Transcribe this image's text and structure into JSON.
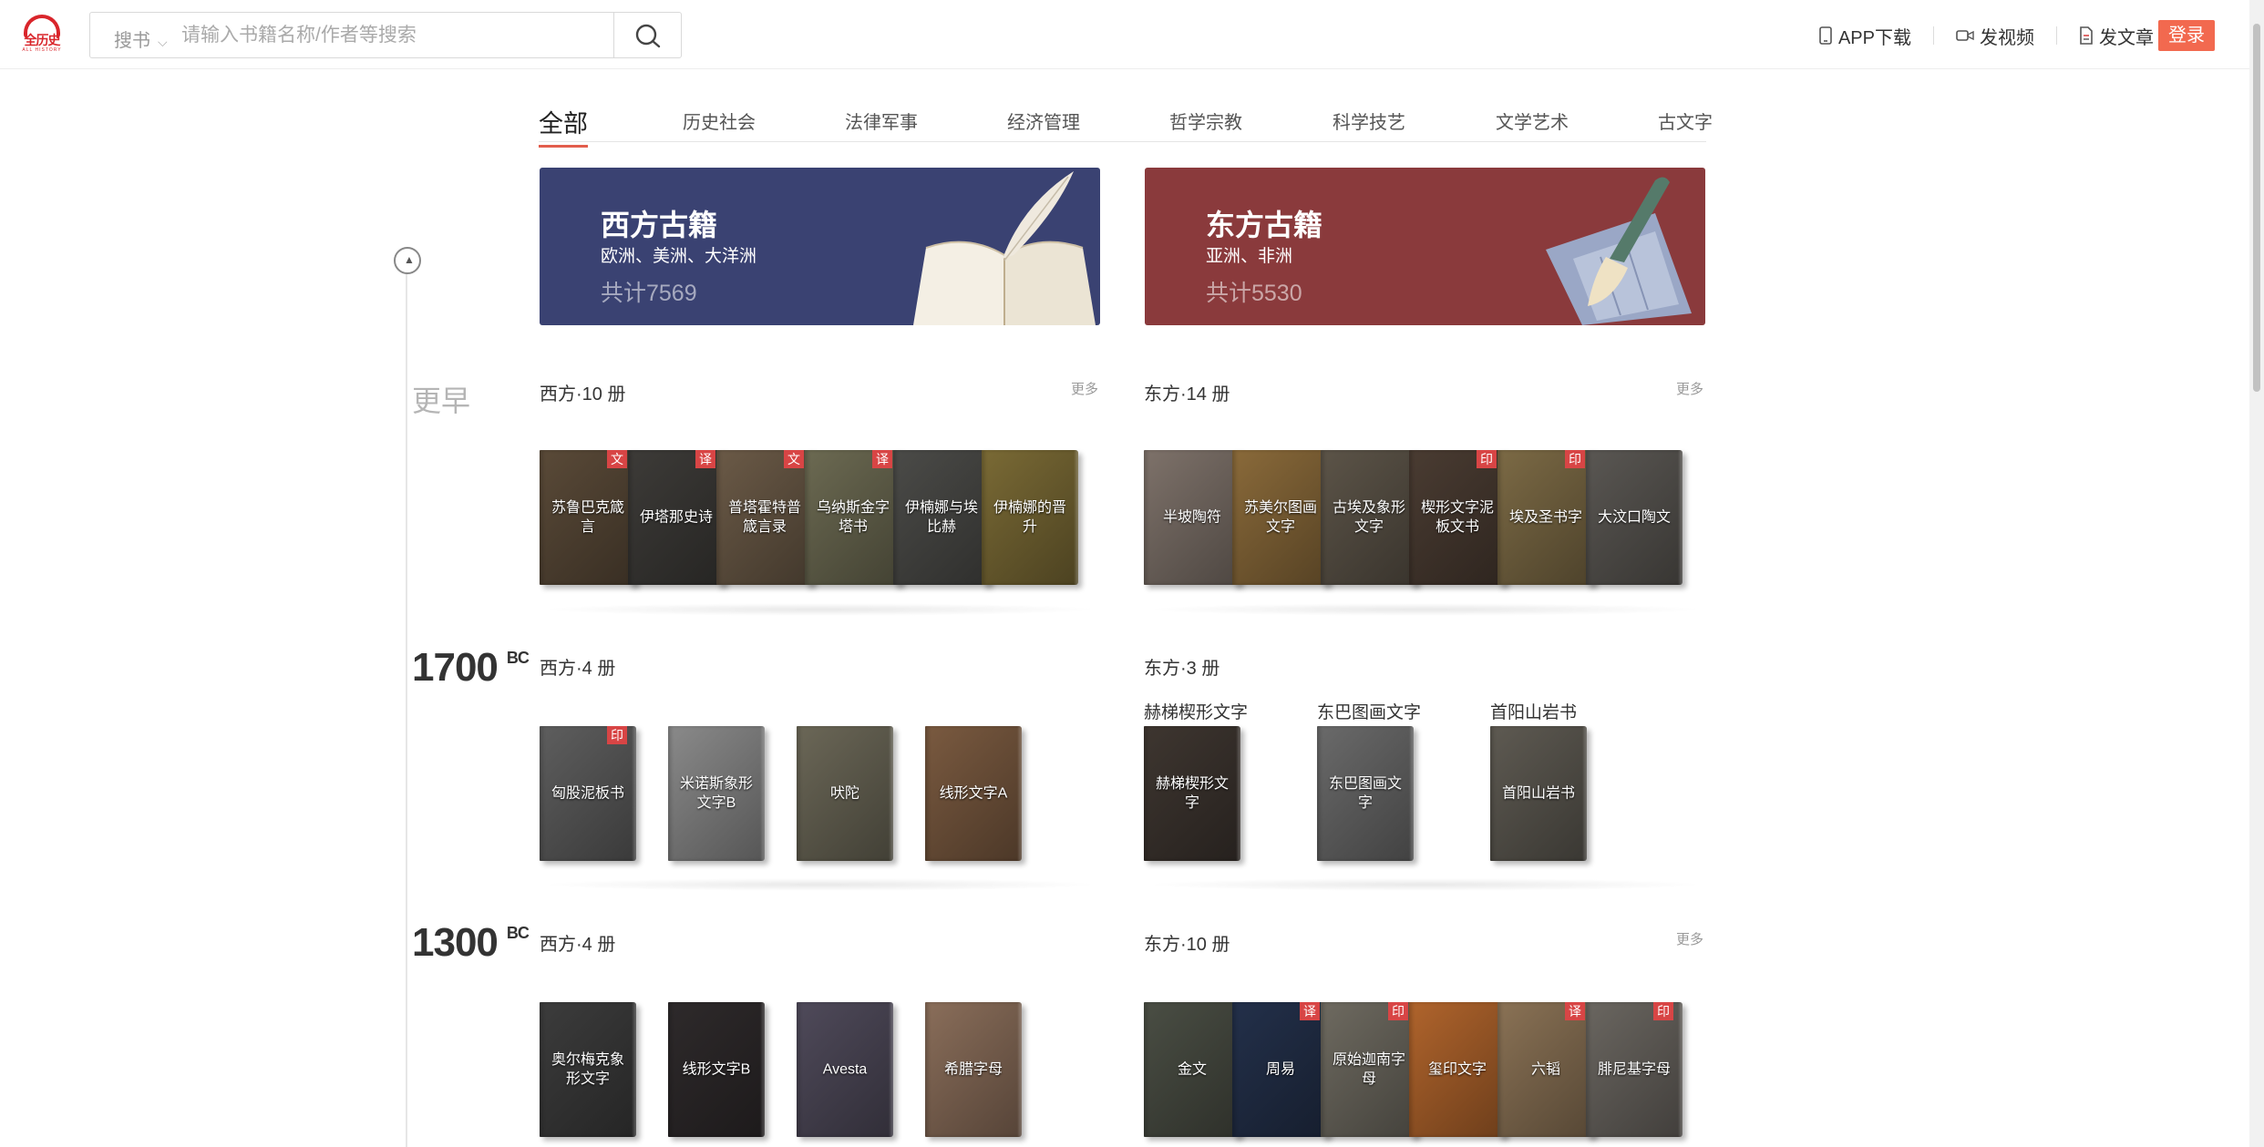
{
  "header": {
    "logo_text": "全历史",
    "logo_sub": "ALL HISTORY",
    "search_category": "搜书",
    "search_placeholder": "请输入书籍名称/作者等搜索",
    "links": [
      "APP下载",
      "发视频",
      "发文章"
    ],
    "login": "登录"
  },
  "tabs": [
    "全部",
    "历史社会",
    "法律军事",
    "经济管理",
    "哲学宗教",
    "科学技艺",
    "文学艺术",
    "古文字"
  ],
  "banners": {
    "west": {
      "title": "西方古籍",
      "subtitle": "欧洲、美洲、大洋洲",
      "count": "共计7569"
    },
    "east": {
      "title": "东方古籍",
      "subtitle": "亚洲、非洲",
      "count": "共计5530"
    }
  },
  "timeline": {
    "earlier": "更早",
    "eras": [
      {
        "year": "1700",
        "suffix": "BC"
      },
      {
        "year": "1300",
        "suffix": "BC"
      }
    ]
  },
  "more_label": "更多",
  "sections": {
    "early_west": {
      "title": "西方·10 册",
      "books": [
        {
          "title": "苏鲁巴克箴言",
          "tag": "文",
          "color": "#5a4a38"
        },
        {
          "title": "伊塔那史诗",
          "tag": "译",
          "color": "#3d3b38"
        },
        {
          "title": "普塔霍特普箴言录",
          "tag": "文",
          "color": "#6b5a47"
        },
        {
          "title": "乌纳斯金字塔书",
          "tag": "译",
          "color": "#6c6a52"
        },
        {
          "title": "伊楠娜与埃比赫",
          "tag": "",
          "color": "#4b4b48"
        },
        {
          "title": "伊楠娜的晋升",
          "tag": "",
          "color": "#7a6a35"
        }
      ]
    },
    "early_east": {
      "title": "东方·14 册",
      "books": [
        {
          "title": "半坡陶符",
          "tag": "",
          "color": "#7e726a"
        },
        {
          "title": "苏美尔图画文字",
          "tag": "",
          "color": "#8a6a3a"
        },
        {
          "title": "古埃及象形文字",
          "tag": "",
          "color": "#5c5448"
        },
        {
          "title": "楔形文字泥板文书",
          "tag": "印",
          "color": "#4a3c32"
        },
        {
          "title": "埃及圣书字",
          "tag": "印",
          "color": "#7c6a45"
        },
        {
          "title": "大汶口陶文",
          "tag": "",
          "color": "#5a5753"
        }
      ]
    },
    "bc1700_west": {
      "title": "西方·4 册",
      "books": [
        {
          "title": "匈股泥板书",
          "tag": "印",
          "color": "#5e5e5e"
        },
        {
          "title": "米诺斯象形文字B",
          "tag": "",
          "color": "#8a8a8a"
        },
        {
          "title": "吠陀",
          "tag": "",
          "color": "#6b6757"
        },
        {
          "title": "线形文字A",
          "tag": "",
          "color": "#7a5a40"
        }
      ]
    },
    "bc1700_east": {
      "title": "东方·3 册",
      "groups": [
        {
          "label": "赫梯楔形文字",
          "book": "赫梯楔形文字",
          "color": "#3e3630"
        },
        {
          "label": "东巴图画文字",
          "book": "东巴图画文字",
          "color": "#6a6a6a"
        },
        {
          "label": "首阳山岩书",
          "book": "首阳山岩书",
          "color": "#5e5a52"
        }
      ]
    },
    "bc1300_west": {
      "title": "西方·4 册",
      "books": [
        {
          "title": "奥尔梅克象形文字",
          "tag": "",
          "color": "#3c3c3c"
        },
        {
          "title": "线形文字B",
          "tag": "",
          "color": "#2e2a2b"
        },
        {
          "title": "Avesta",
          "tag": "",
          "color": "#4f4a5a"
        },
        {
          "title": "希腊字母",
          "tag": "",
          "color": "#8a6e5a"
        }
      ]
    },
    "bc1300_east": {
      "title": "东方·10 册",
      "books": [
        {
          "title": "金文",
          "tag": "",
          "color": "#4a4e44"
        },
        {
          "title": "周易",
          "tag": "译",
          "color": "#23304a"
        },
        {
          "title": "原始迦南字母",
          "tag": "印",
          "color": "#6e6a60"
        },
        {
          "title": "玺印文字",
          "tag": "",
          "color": "#b0642c"
        },
        {
          "title": "六韬",
          "tag": "译",
          "color": "#8a7255"
        },
        {
          "title": "腓尼基字母",
          "tag": "印",
          "color": "#6a6660"
        }
      ]
    }
  }
}
